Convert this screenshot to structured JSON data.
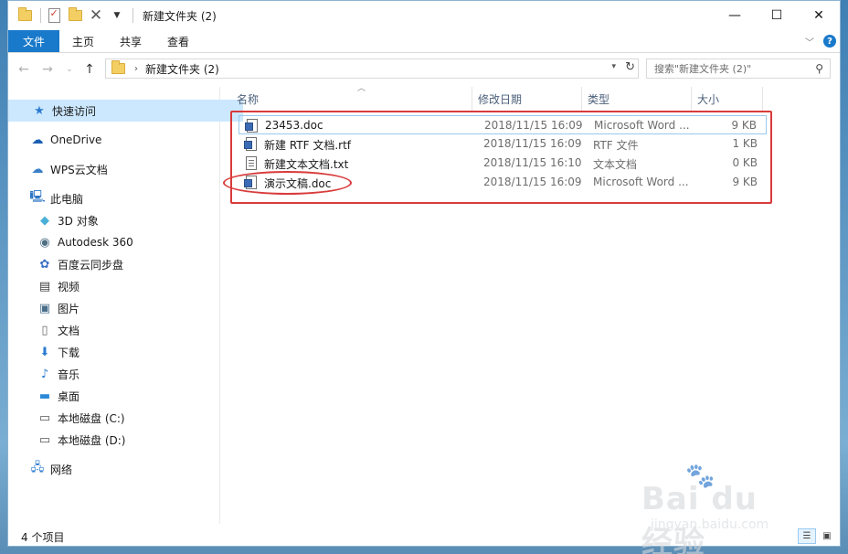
{
  "window": {
    "title": "新建文件夹 (2)",
    "controls": {
      "minimize": "—",
      "maximize": "☐",
      "close": "✕"
    }
  },
  "ribbon": {
    "tabs": [
      "文件",
      "主页",
      "共享",
      "查看"
    ],
    "help": "?"
  },
  "address": {
    "path": "新建文件夹 (2)",
    "search_placeholder": "搜索\"新建文件夹 (2)\""
  },
  "navpane": {
    "items": [
      {
        "label": "快速访问",
        "icon": "star-icon"
      },
      {
        "label": "OneDrive",
        "icon": "cloud-icon"
      },
      {
        "label": "WPS云文档",
        "icon": "cloud-outline-icon"
      },
      {
        "label": "此电脑",
        "icon": "monitor-icon"
      },
      {
        "label": "3D 对象",
        "icon": "cube-icon"
      },
      {
        "label": "Autodesk 360",
        "icon": "autodesk-icon"
      },
      {
        "label": "百度云同步盘",
        "icon": "baidu-sync-icon"
      },
      {
        "label": "视频",
        "icon": "video-icon"
      },
      {
        "label": "图片",
        "icon": "picture-icon"
      },
      {
        "label": "文档",
        "icon": "document-icon"
      },
      {
        "label": "下载",
        "icon": "download-icon"
      },
      {
        "label": "音乐",
        "icon": "music-icon"
      },
      {
        "label": "桌面",
        "icon": "desktop-icon"
      },
      {
        "label": "本地磁盘 (C:)",
        "icon": "drive-icon"
      },
      {
        "label": "本地磁盘 (D:)",
        "icon": "drive-icon"
      },
      {
        "label": "网络",
        "icon": "network-icon"
      }
    ]
  },
  "list": {
    "columns": [
      "名称",
      "修改日期",
      "类型",
      "大小"
    ],
    "files": [
      {
        "name": "23453.doc",
        "date": "2018/11/15 16:09",
        "type": "Microsoft Word ...",
        "size": "9 KB",
        "icon": "word-doc-icon"
      },
      {
        "name": "新建 RTF 文档.rtf",
        "date": "2018/11/15 16:09",
        "type": "RTF 文件",
        "size": "1 KB",
        "icon": "rtf-doc-icon"
      },
      {
        "name": "新建文本文档.txt",
        "date": "2018/11/15 16:10",
        "type": "文本文档",
        "size": "0 KB",
        "icon": "text-file-icon"
      },
      {
        "name": "演示文稿.doc",
        "date": "2018/11/15 16:09",
        "type": "Microsoft Word ...",
        "size": "9 KB",
        "icon": "word-doc-icon"
      }
    ]
  },
  "status": {
    "item_count": "4 个项目"
  },
  "watermark": {
    "brand": "Bai du 经验",
    "url": "jingyan.baidu.com"
  },
  "colors": {
    "accent": "#1979ca",
    "selection": "#cce8ff",
    "annotation": "#d93b3b"
  }
}
